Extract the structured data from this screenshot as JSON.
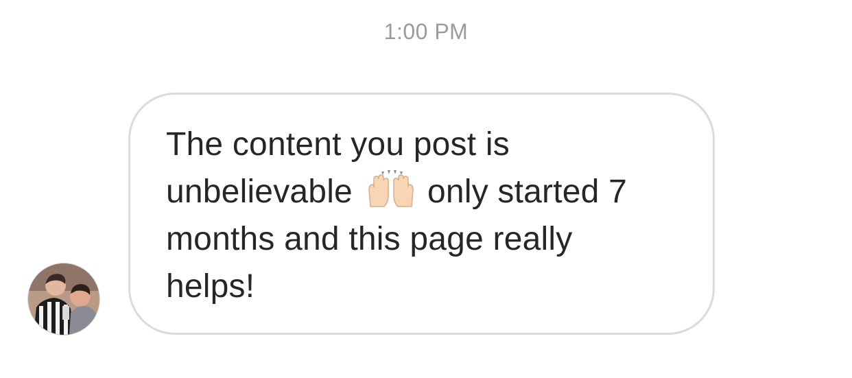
{
  "thread": {
    "timestamp": "1:00 PM"
  },
  "message": {
    "text_part1": "The content you post is\nunbelievable ",
    "emoji": "raising-hands-emoji",
    "text_part2": " only started 7\nmonths and this page really\nhelps!"
  },
  "colors": {
    "timestamp": "#9b9b9b",
    "bubble_border": "#dbdbdb",
    "message_text": "#262626",
    "background": "#ffffff"
  }
}
